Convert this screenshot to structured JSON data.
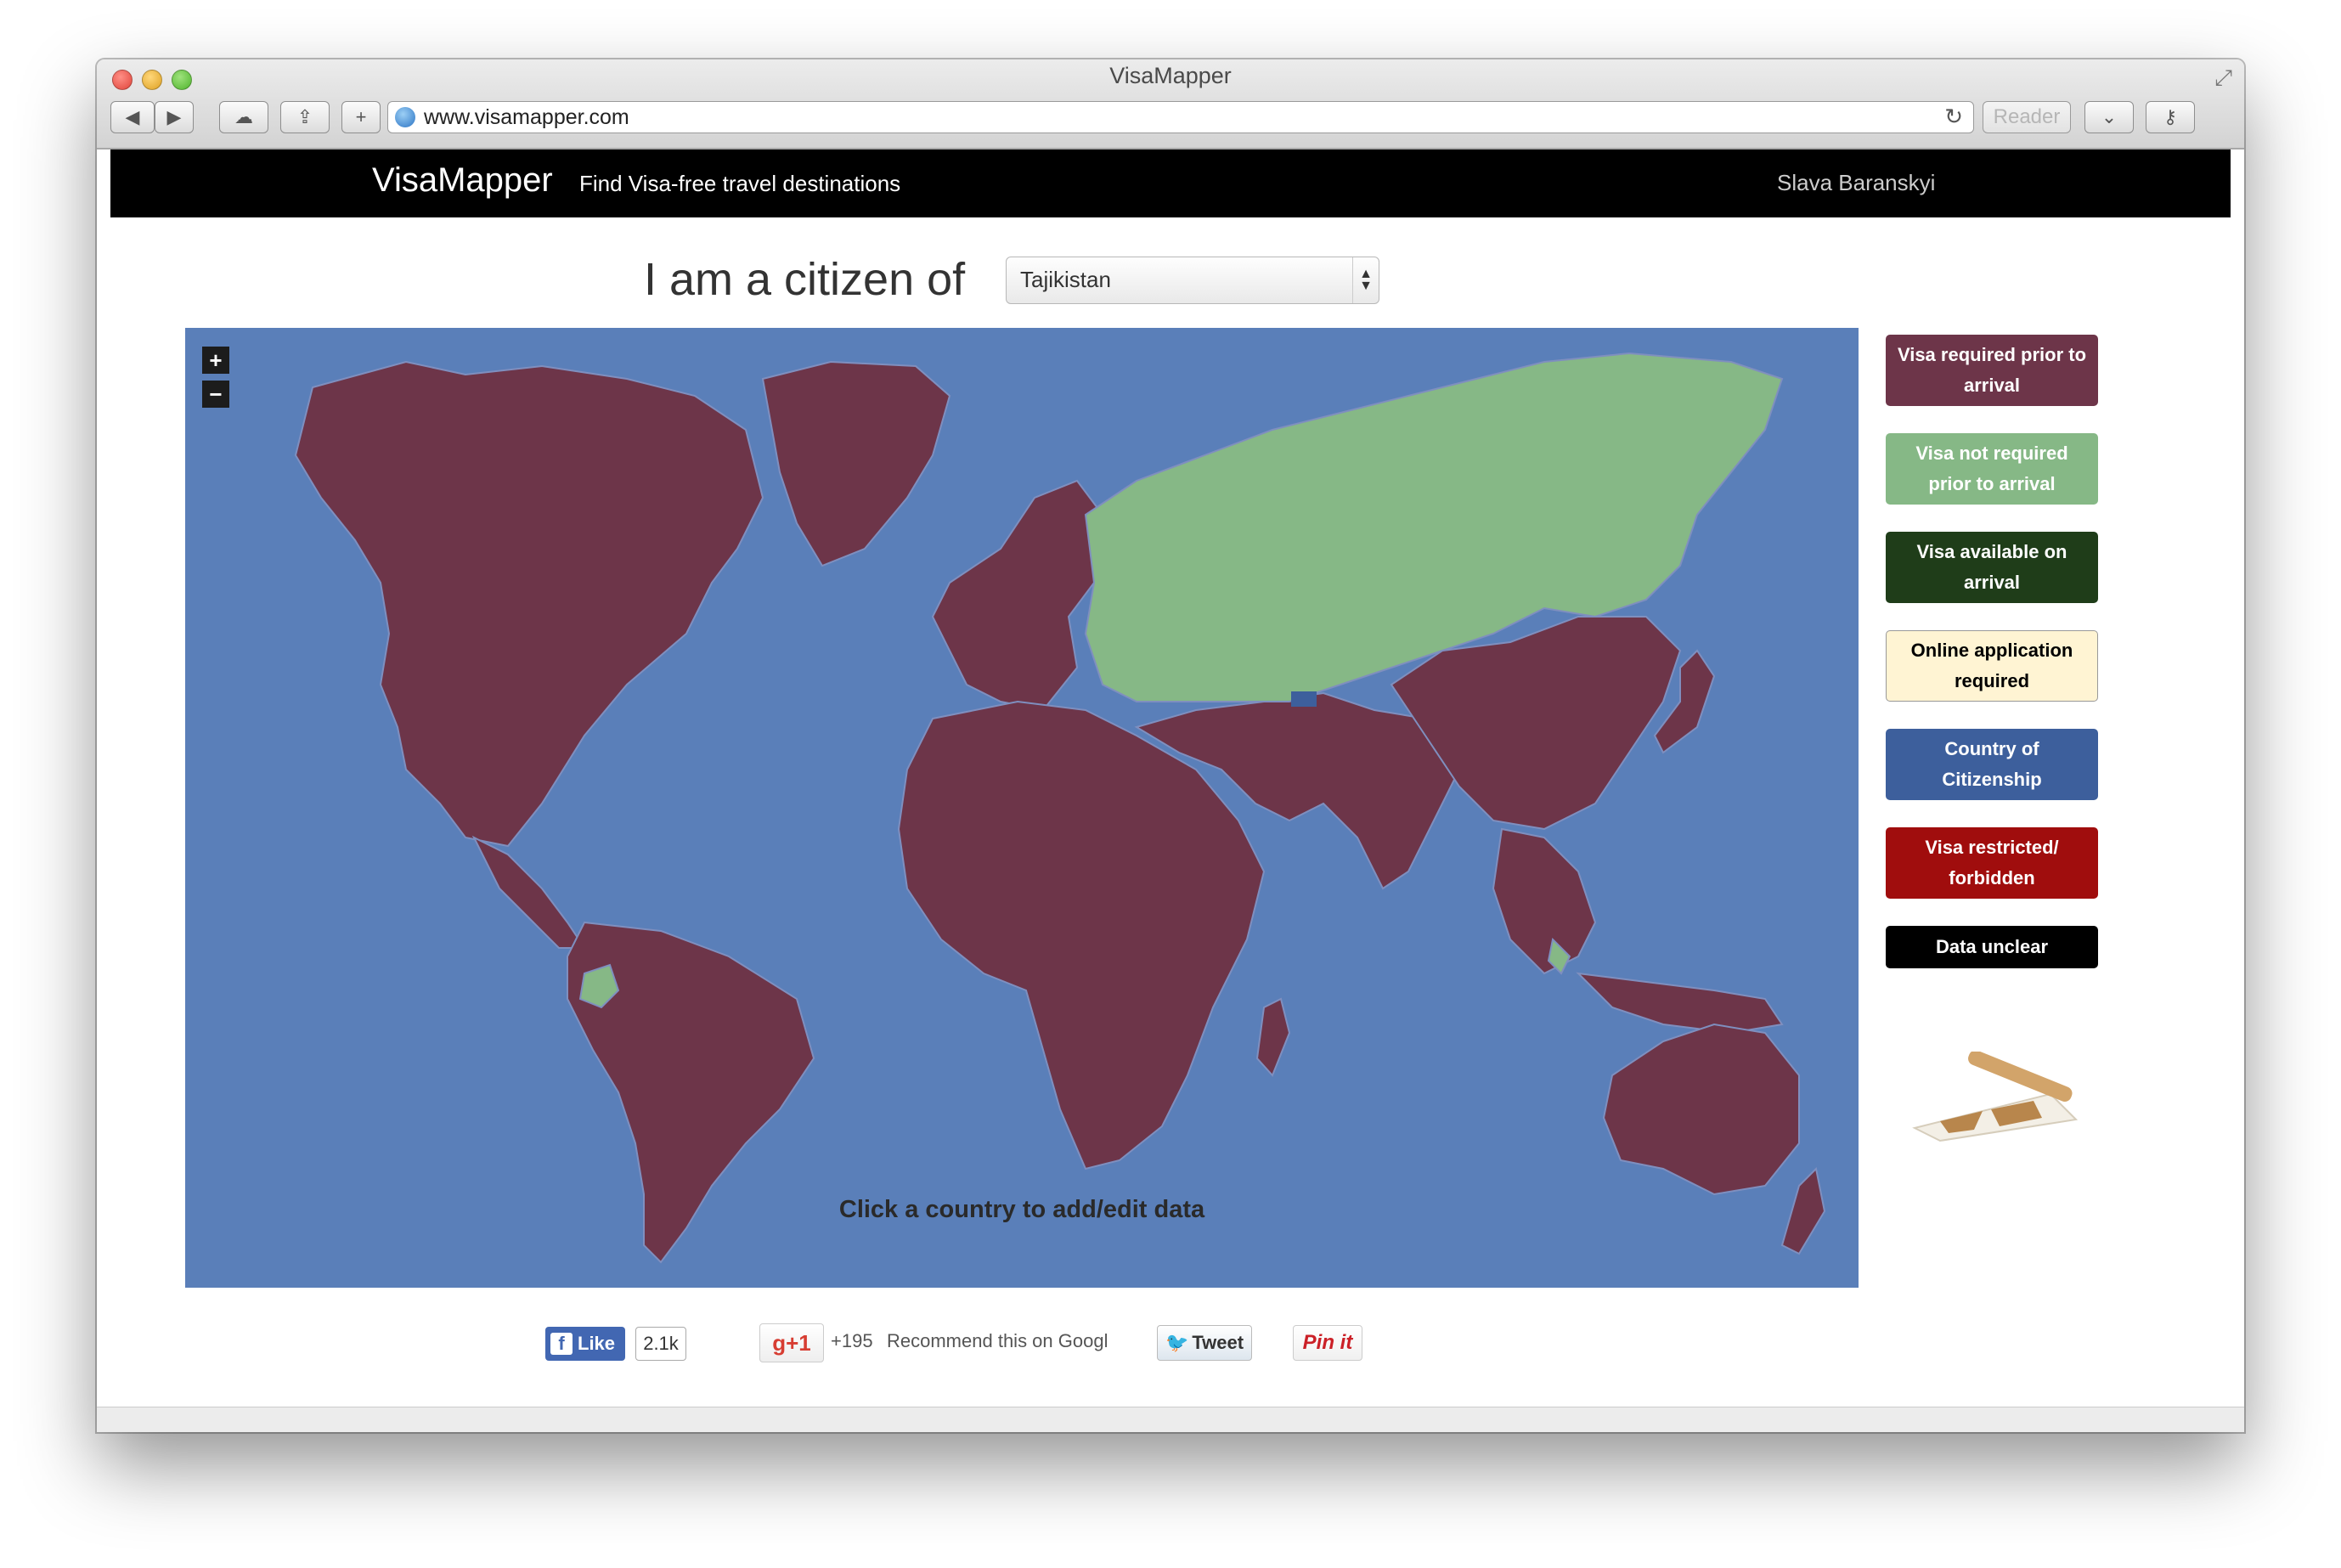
{
  "browser": {
    "window_title": "VisaMapper",
    "url": "www.visamapper.com",
    "reader_label": "Reader",
    "toolbar_glyphs": {
      "back": "◀",
      "forward": "▶",
      "cloud": "☁",
      "share": "⇪",
      "new_tab": "+",
      "reload": "↻",
      "pocket": "⌄",
      "key": "⚷",
      "shield": "⛨",
      "download": "⬇",
      "resize": "⤢"
    }
  },
  "navbar": {
    "brand": "VisaMapper",
    "tagline": "Find Visa-free travel destinations",
    "user": "Slava Baranskyi"
  },
  "citizen": {
    "label": "I am a citizen of",
    "selected": "Tajikistan",
    "arrow_up": "▲",
    "arrow_down": "▼"
  },
  "map": {
    "zoom_in": "+",
    "zoom_out": "−",
    "hint": "Click a country to add/edit data",
    "colors": {
      "ocean": "#5a7fb9",
      "visa_required": "#6d3549",
      "visa_not_required": "#86b886",
      "citizenship": "#3d5f9c"
    }
  },
  "legend": [
    {
      "id": "visa-required",
      "label": "Visa required prior to arrival",
      "bg": "#6d3549",
      "fg": "#ffffff"
    },
    {
      "id": "visa-not-required",
      "label": "Visa not required prior to arrival",
      "bg": "#86b886",
      "fg": "#ffffff"
    },
    {
      "id": "visa-on-arrival",
      "label": "Visa available on arrival",
      "bg": "#1f3d19",
      "fg": "#ffffff"
    },
    {
      "id": "online-application",
      "label": "Online application required",
      "bg": "#fff4d3",
      "fg": "#000000"
    },
    {
      "id": "country-of-citizenship",
      "label": "Country of Citizenship",
      "bg": "#3d5f9c",
      "fg": "#ffffff"
    },
    {
      "id": "visa-restricted",
      "label": "Visa restricted/ forbidden",
      "bg": "#a00d0d",
      "fg": "#ffffff"
    },
    {
      "id": "data-unclear",
      "label": "Data unclear",
      "bg": "#000000",
      "fg": "#ffffff"
    }
  ],
  "social": {
    "fb_icon": "f",
    "fb_like": "Like",
    "fb_count": "2.1k",
    "gplus_label": "g+1",
    "gplus_count": "+195",
    "gplus_text": "Recommend this on Googl",
    "twitter_icon": "🐦",
    "tweet": "Tweet",
    "pin": "Pin it"
  }
}
